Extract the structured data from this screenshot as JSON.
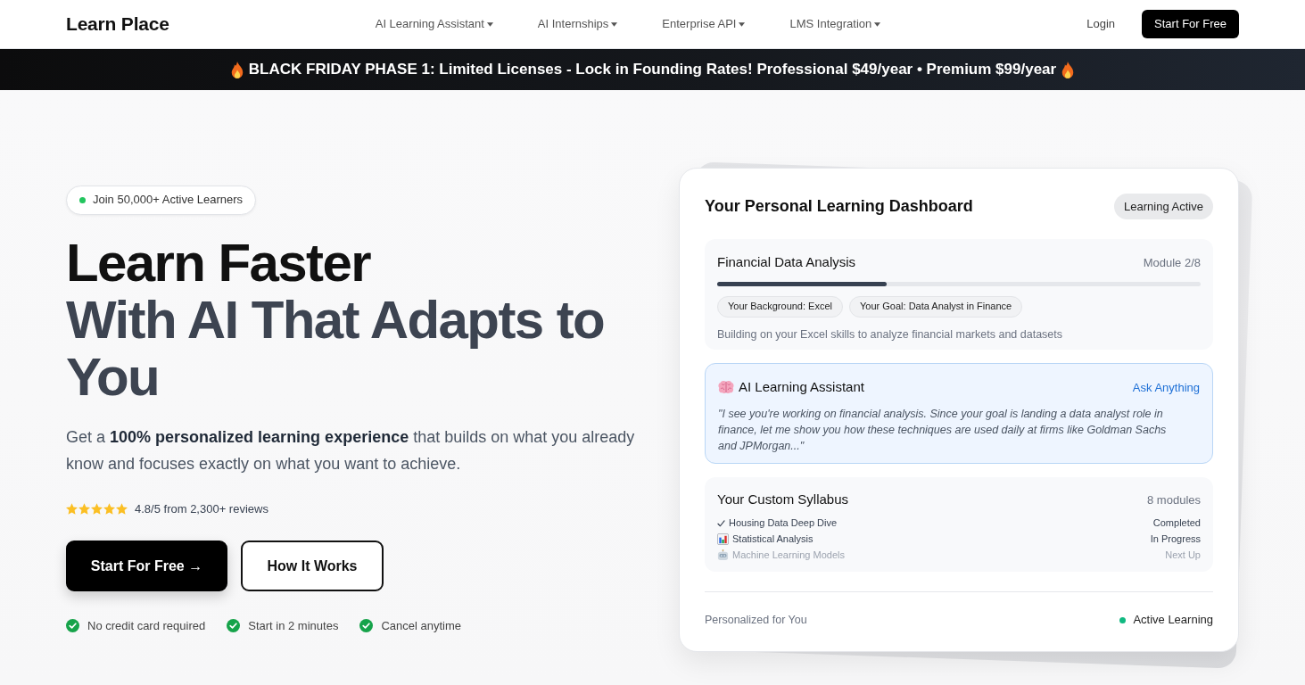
{
  "navbar": {
    "logo": "Learn Place",
    "menu": [
      {
        "label": "AI Learning Assistant",
        "has_menu": true
      },
      {
        "label": "AI Internships",
        "has_menu": true
      },
      {
        "label": "Enterprise API",
        "has_menu": true
      },
      {
        "label": "LMS Integration",
        "has_menu": true
      }
    ],
    "login": "Login",
    "cta": "Start For Free"
  },
  "promo_banner": {
    "text": "BLACK FRIDAY PHASE 1: Limited Licenses - Lock in Founding Rates! Professional $49/year • Premium $99/year"
  },
  "hero": {
    "badge": "Join 50,000+ Active Learners",
    "headline": [
      "Learn Faster",
      "With AI That Adapts to You"
    ],
    "subheadline": "Get a **100% personalized learning experience** that builds on what you already know and focuses exactly on what you want to achieve.",
    "rating": {
      "stars": 5,
      "text": "4.8/5 from 2,300+ reviews"
    },
    "buttons": [
      {
        "label": "Start For Free →",
        "kind": "primary"
      },
      {
        "label": "How It Works",
        "kind": "outline"
      }
    ],
    "perks": [
      "No credit card required",
      "Start in 2 minutes",
      "Cancel anytime"
    ]
  },
  "dashboard": {
    "title": "Your Personal Learning Dashboard",
    "status": "Learning Active",
    "course": {
      "name": "Financial Data Analysis",
      "progress_text": "Module 2/8",
      "level": 0.35,
      "tags": [
        "Your Background: Excel",
        "Your Goal: Data Analyst in Finance"
      ],
      "description": "Building on your Excel skills to analyze financial markets and datasets"
    },
    "assistant": {
      "title": "AI Learning Assistant",
      "link": "Ask Anything",
      "message": "\"I see you're working on financial analysis. Since your goal is landing a data analyst role in finance, let me show you how these techniques are used daily at firms like Goldman Sachs and JPMorgan...\""
    },
    "syllabus": {
      "title": "Your Custom Syllabus",
      "count": "8 modules",
      "items": [
        {
          "name": "Housing Data Deep Dive",
          "status": "Completed",
          "kind": "completed"
        },
        {
          "name": "Statistical Analysis",
          "status": "In Progress",
          "kind": "in_progress"
        },
        {
          "name": "Machine Learning Models",
          "status": "Next Up",
          "kind": "next"
        }
      ]
    },
    "footer": {
      "note": "Personalized for You",
      "status": "Active Learning"
    }
  }
}
